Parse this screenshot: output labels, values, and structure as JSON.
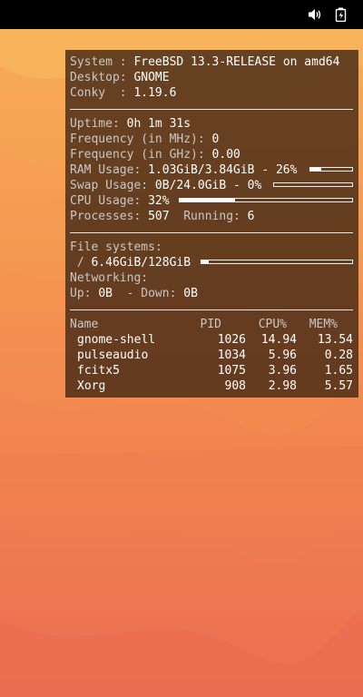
{
  "system": {
    "system_label": "System : ",
    "system_value": "FreeBSD 13.3-RELEASE on amd64",
    "desktop_label": "Desktop: ",
    "desktop_value": "GNOME",
    "conky_label": "Conky  : ",
    "conky_value": "1.19.6"
  },
  "stats": {
    "uptime_label": "Uptime: ",
    "uptime_value": "0h 1m 31s",
    "freq_mhz_label": "Frequency (in MHz): ",
    "freq_mhz_value": "0",
    "freq_ghz_label": "Frequency (in GHz): ",
    "freq_ghz_value": "0.00",
    "ram_label": "RAM Usage: ",
    "ram_value": "1.03GiB/3.84GiB - 26%",
    "ram_percent": 26,
    "swap_label": "Swap Usage: ",
    "swap_value": "0B/24.0GiB - 0%",
    "swap_percent": 0,
    "cpu_label": "CPU Usage: ",
    "cpu_value": "32%",
    "cpu_percent": 32,
    "processes_label": "Processes: ",
    "processes_value": "507",
    "running_label": "  Running: ",
    "running_value": "6"
  },
  "storage": {
    "fs_label": "File systems:",
    "root_label": " / ",
    "root_value": "6.46GiB/128GiB",
    "root_percent": 5,
    "net_label": "Networking:",
    "up_label": "Up: ",
    "up_value": "0B",
    "down_label": "  - Down: ",
    "down_value": "0B"
  },
  "processes": {
    "headers": {
      "name": "Name",
      "pid": "PID",
      "cpu": "CPU%",
      "mem": "MEM%"
    },
    "rows": [
      {
        "name": "gnome-shell",
        "pid": "1026",
        "cpu": "14.94",
        "mem": "13.54"
      },
      {
        "name": "pulseaudio",
        "pid": "1034",
        "cpu": "5.96",
        "mem": "0.28"
      },
      {
        "name": "fcitx5",
        "pid": "1075",
        "cpu": "3.96",
        "mem": "1.65"
      },
      {
        "name": "Xorg",
        "pid": "908",
        "cpu": "2.98",
        "mem": "5.57"
      }
    ]
  },
  "tray": {
    "icons": [
      "volume-icon",
      "battery-icon"
    ]
  },
  "colors": {
    "panel_bg": "#462a16",
    "wallpaper_top": "#f7ad56",
    "wallpaper_bottom": "#ec6e52",
    "topbar_bg": "#000000"
  }
}
